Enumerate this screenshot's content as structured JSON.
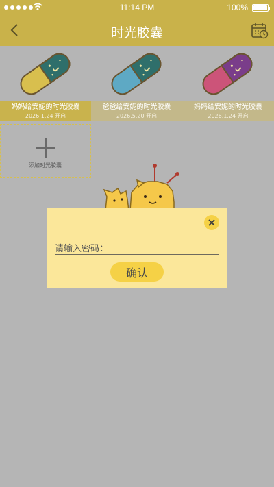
{
  "status_bar": {
    "time": "11:14 PM",
    "battery": "100%"
  },
  "header": {
    "title": "时光胶囊"
  },
  "capsules": [
    {
      "name": "妈妈给安妮的时光胶囊",
      "date": "2026.1.24 开启",
      "color": "#d8bf4e",
      "selected": true
    },
    {
      "name": "爸爸给安妮的时光胶囊",
      "date": "2026.5.20 开启",
      "color": "#5ea9c4",
      "selected": false
    },
    {
      "name": "妈妈给安妮的时光胶囊",
      "date": "2026.1.24 开启",
      "color": "#cc5479",
      "selected": false
    }
  ],
  "add_capsule": {
    "label": "添加时光胶囊"
  },
  "dialog": {
    "password_label": "请输入密码：",
    "password_value": "",
    "confirm_label": "确认"
  },
  "colors": {
    "accent": "#c9b24a",
    "dialog_bg": "#fbe79a",
    "button": "#f5d146",
    "capsule_top": "#2f6f6b"
  }
}
